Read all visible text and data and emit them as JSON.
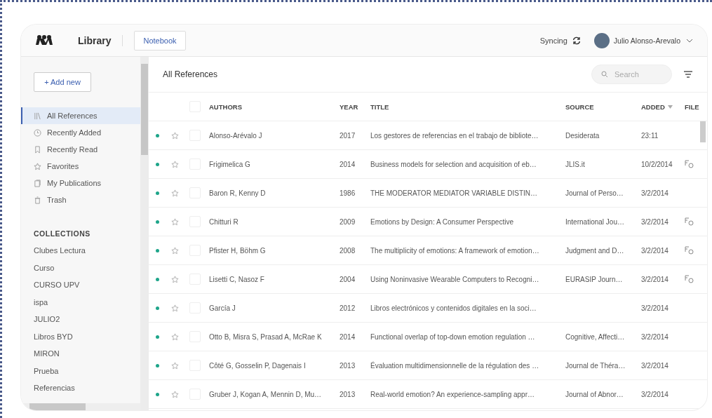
{
  "topbar": {
    "app_title": "Library",
    "tab": {
      "label": "Notebook",
      "selected": false
    },
    "sync_status": "Syncing",
    "user_name": "Julio Alonso-Arevalo"
  },
  "sidebar": {
    "add_button": "+ Add new",
    "items": [
      {
        "label": "All References",
        "selected": true
      },
      {
        "label": "Recently Added",
        "selected": false
      },
      {
        "label": "Recently Read",
        "selected": false
      },
      {
        "label": "Favorites",
        "selected": false
      },
      {
        "label": "My Publications",
        "selected": false
      },
      {
        "label": "Trash",
        "selected": false
      }
    ],
    "collections_heading": "COLLECTIONS",
    "collections": [
      "Clubes Lectura",
      "Curso",
      "CURSO UPV",
      "ispa",
      "JULIO2",
      "Libros BYD",
      "MIRON",
      "Prueba",
      "Referencias"
    ]
  },
  "main": {
    "title": "All References",
    "search": {
      "placeholder": "Search"
    },
    "select_all_checked": false,
    "columns": [
      {
        "label": "AUTHORS",
        "sorted": false
      },
      {
        "label": "YEAR",
        "sorted": false
      },
      {
        "label": "TITLE",
        "sorted": false
      },
      {
        "label": "SOURCE",
        "sorted": false
      },
      {
        "label": "ADDED",
        "sorted": true
      },
      {
        "label": "FILE",
        "sorted": false
      }
    ],
    "rows": [
      {
        "authors": "Alonso-Arévalo J",
        "year": "2017",
        "title": "Los gestores de referencias en el trabajo de bibliote…",
        "source": "Desiderata",
        "added": "23:11",
        "has_file": false,
        "unread": true,
        "starred": false,
        "checked": false
      },
      {
        "authors": "Frigimelica G",
        "year": "2014",
        "title": "Business models for selection and acquisition of eb…",
        "source": "JLIS.it",
        "added": "10/2/2014",
        "has_file": true,
        "unread": true,
        "starred": false,
        "checked": false
      },
      {
        "authors": "Baron R, Kenny D",
        "year": "1986",
        "title": "THE MODERATOR MEDIATOR VARIABLE DISTIN…",
        "source": "Journal of Perso…",
        "added": "3/2/2014",
        "has_file": false,
        "unread": true,
        "starred": false,
        "checked": false
      },
      {
        "authors": "Chitturi R",
        "year": "2009",
        "title": "Emotions by Design: A Consumer Perspective",
        "source": "International Jou…",
        "added": "3/2/2014",
        "has_file": true,
        "unread": true,
        "starred": false,
        "checked": false
      },
      {
        "authors": "Pfister H, Böhm G",
        "year": "2008",
        "title": "The multiplicity of emotions: A framework of emotion…",
        "source": "Judgment and D…",
        "added": "3/2/2014",
        "has_file": true,
        "unread": true,
        "starred": false,
        "checked": false
      },
      {
        "authors": "Lisetti C, Nasoz F",
        "year": "2004",
        "title": "Using Noninvasive Wearable Computers to Recogni…",
        "source": "EURASIP Journ…",
        "added": "3/2/2014",
        "has_file": true,
        "unread": true,
        "starred": false,
        "checked": false
      },
      {
        "authors": "García J",
        "year": "2012",
        "title": "Libros electrónicos y contenidos digitales en la soci…",
        "source": "",
        "added": "3/2/2014",
        "has_file": false,
        "unread": true,
        "starred": false,
        "checked": false
      },
      {
        "authors": "Otto B, Misra S, Prasad A, McRae K",
        "year": "2014",
        "title": "Functional overlap of top-down emotion regulation …",
        "source": "Cognitive, Affecti…",
        "added": "3/2/2014",
        "has_file": false,
        "unread": true,
        "starred": false,
        "checked": false
      },
      {
        "authors": "Côté G, Gosselin P, Dagenais I",
        "year": "2013",
        "title": "Évaluation multidimensionnelle de la régulation des …",
        "source": "Journal de Théra…",
        "added": "3/2/2014",
        "has_file": false,
        "unread": true,
        "starred": false,
        "checked": false
      },
      {
        "authors": "Gruber J, Kogan A, Mennin D, Mu…",
        "year": "2013",
        "title": "Real-world emotion? An experience-sampling appr…",
        "source": "Journal of Abnor…",
        "added": "3/2/2014",
        "has_file": false,
        "unread": true,
        "starred": false,
        "checked": false
      }
    ]
  }
}
